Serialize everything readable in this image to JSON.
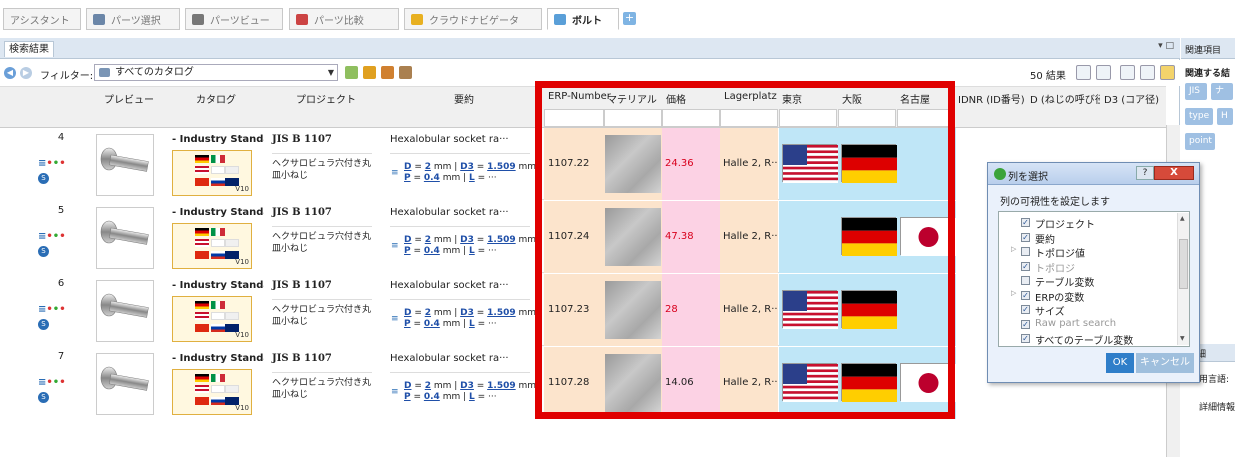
{
  "tabs": [
    {
      "label": "アシスタント",
      "icon": "assistant-icon"
    },
    {
      "label": "パーツ選択",
      "icon": "database-icon"
    },
    {
      "label": "パーツビュー",
      "icon": "parts-view-icon"
    },
    {
      "label": "パーツ比較",
      "icon": "compare-icon"
    },
    {
      "label": "クラウドナビゲータ",
      "icon": "cloud-nav-icon"
    },
    {
      "label": "ボルト",
      "icon": "abc-icon"
    }
  ],
  "panel": {
    "title": "検索結果",
    "controls": "▾ □"
  },
  "filter": {
    "label": "フィルター:",
    "value": "すべてのカタログ",
    "results": "50 結果"
  },
  "columns": {
    "preview": "プレビュー",
    "catalog": "カタログ",
    "project": "プロジェクト",
    "summary": "要約",
    "erp": "ERP-Number",
    "material": "マテリアル",
    "price": "価格",
    "lager": "Lagerplatz",
    "tokyo": "東京",
    "osaka": "大阪",
    "nagoya": "名古屋",
    "idnr": "IDNR (ID番号)",
    "d": "D (ねじの呼び径)",
    "d3": "D3 (コア径)"
  },
  "rows": [
    {
      "num": "4",
      "catalog": "- Industry Standa",
      "project": "JIS B 1107",
      "project_desc": "ヘクサロビュラ穴付き丸皿小ねじ",
      "summary": "Hexalobular socket ra···",
      "summary_l1": "D = 2 mm | D3 = 1.509 mm |",
      "summary_l2": "P = 0.4 mm | L = ···",
      "erp": "1107.22",
      "price": "24.36",
      "price_color": "#d8001c",
      "lager": "Halle 2, R···",
      "tokyo": "us",
      "osaka": "de",
      "nagoya": ""
    },
    {
      "num": "5",
      "catalog": "- Industry Standa",
      "project": "JIS B 1107",
      "project_desc": "ヘクサロビュラ穴付き丸皿小ねじ",
      "summary": "Hexalobular socket ra···",
      "summary_l1": "D = 2 mm | D3 = 1.509 mm |",
      "summary_l2": "P = 0.4 mm | L = ···",
      "erp": "1107.24",
      "price": "47.38",
      "price_color": "#d8001c",
      "lager": "Halle 2, R···",
      "tokyo": "",
      "osaka": "de",
      "nagoya": "jp"
    },
    {
      "num": "6",
      "catalog": "- Industry Standa",
      "project": "JIS B 1107",
      "project_desc": "ヘクサロビュラ穴付き丸皿小ねじ",
      "summary": "Hexalobular socket ra···",
      "summary_l1": "D = 2 mm | D3 = 1.509 mm |",
      "summary_l2": "P = 0.4 mm | L = ···",
      "erp": "1107.23",
      "price": "28",
      "price_color": "#d8001c",
      "lager": "Halle 2, R···",
      "tokyo": "us",
      "osaka": "de",
      "nagoya": ""
    },
    {
      "num": "7",
      "catalog": "- Industry Standa",
      "project": "JIS B 1107",
      "project_desc": "ヘクサロビュラ穴付き丸皿小ねじ",
      "summary": "Hexalobular socket ra···",
      "summary_l1": "D = 2 mm | D3 = 1.509 mm |",
      "summary_l2": "P = 0.4 mm | L = ···",
      "erp": "1107.28",
      "price": "14.06",
      "price_color": "#222222",
      "lager": "Halle 2, R···",
      "tokyo": "us",
      "osaka": "de",
      "nagoya": "jp"
    }
  ],
  "catalog_version": "V10",
  "right_panel": {
    "title": "関連項目",
    "subtitle": "関連する結",
    "tags": [
      "JIS",
      "ナ",
      "type",
      "H",
      "point"
    ],
    "lower_tab": "細",
    "lower_text1": "用言語:",
    "lower_text2": "詳細情報"
  },
  "dialog": {
    "title": "列を選択",
    "prompt": "列の可視性を設定します",
    "items": [
      {
        "label": "プロジェクト",
        "checked": true,
        "dim": false,
        "expand": false
      },
      {
        "label": "要約",
        "checked": true,
        "dim": false,
        "expand": false
      },
      {
        "label": "トポロジ値",
        "checked": false,
        "dim": false,
        "expand": true
      },
      {
        "label": "トポロジ",
        "checked": true,
        "dim": true,
        "expand": false
      },
      {
        "label": "テーブル変数",
        "checked": false,
        "dim": false,
        "expand": false
      },
      {
        "label": "ERPの変数",
        "checked": true,
        "dim": false,
        "expand": true
      },
      {
        "label": "サイズ",
        "checked": true,
        "dim": false,
        "expand": false
      },
      {
        "label": "Raw part search",
        "checked": true,
        "dim": true,
        "expand": false
      },
      {
        "label": "すべてのテーブル変数",
        "checked": true,
        "dim": false,
        "expand": false
      }
    ],
    "ok": "OK",
    "cancel": "キャンセル",
    "help": "?",
    "close": "X"
  },
  "colors": {
    "erp_bg": "#fce4cc",
    "price_bg": "#fcd2e4",
    "city_bg": "#bfe6f7",
    "highlight": "#e00000",
    "accent": "#2f7ec9"
  }
}
